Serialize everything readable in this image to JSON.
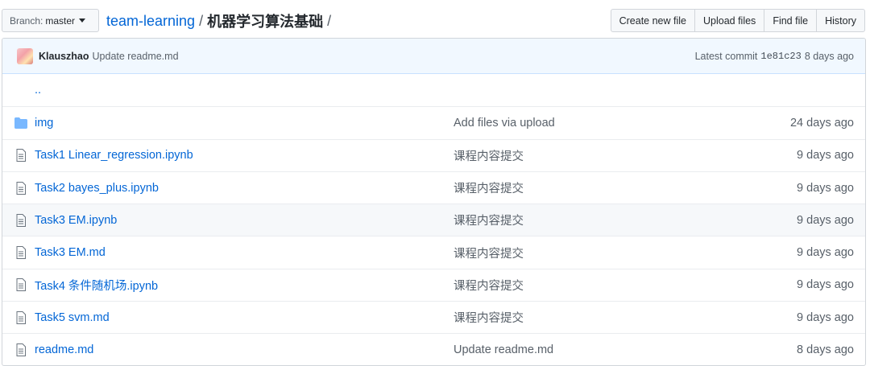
{
  "branch": {
    "prefix": "Branch:",
    "name": "master"
  },
  "breadcrumb": {
    "repo": "team-learning",
    "sep1": "/",
    "dir": "机器学习算法基础",
    "sep2": "/"
  },
  "buttons": {
    "create": "Create new file",
    "upload": "Upload files",
    "find": "Find file",
    "history": "History"
  },
  "commit": {
    "author": "Klauszhao",
    "message": "Update readme.md",
    "latest_label": "Latest commit",
    "sha": "1e81c23",
    "age": "8 days ago"
  },
  "parent_link": "..",
  "files": [
    {
      "type": "folder",
      "name": "img",
      "message": "Add files via upload",
      "age": "24 days ago"
    },
    {
      "type": "file",
      "name": "Task1 Linear_regression.ipynb",
      "message": "课程内容提交",
      "age": "9 days ago"
    },
    {
      "type": "file",
      "name": "Task2 bayes_plus.ipynb",
      "message": "课程内容提交",
      "age": "9 days ago"
    },
    {
      "type": "file",
      "name": "Task3 EM.ipynb",
      "message": "课程内容提交",
      "age": "9 days ago"
    },
    {
      "type": "file",
      "name": "Task3 EM.md",
      "message": "课程内容提交",
      "age": "9 days ago"
    },
    {
      "type": "file",
      "name": "Task4 条件随机场.ipynb",
      "message": "课程内容提交",
      "age": "9 days ago"
    },
    {
      "type": "file",
      "name": "Task5 svm.md",
      "message": "课程内容提交",
      "age": "9 days ago"
    },
    {
      "type": "file",
      "name": "readme.md",
      "message": "Update readme.md",
      "age": "8 days ago"
    }
  ],
  "colors": {
    "link": "#0366d6",
    "folder": "#79b8ff",
    "file": "#6a737d",
    "commit_bg": "#f1f8ff"
  }
}
